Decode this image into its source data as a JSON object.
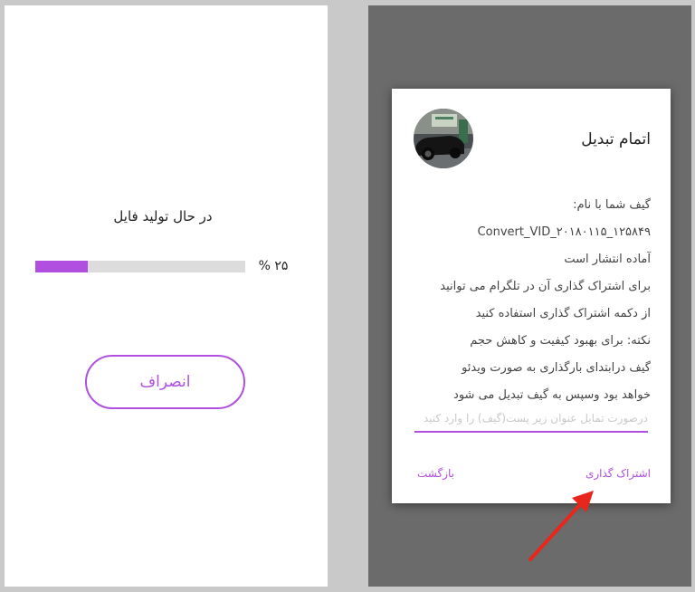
{
  "progress_screen": {
    "title": "در حال تولید فایل",
    "progress": 0.25,
    "percent_label": "۲۵ %",
    "cancel_label": "انصراف"
  },
  "dialog": {
    "title": "اتمام تبدیل",
    "message_lines": [
      "گیف شما با نام:",
      "Convert_VID_۲۰۱۸۰۱۱۵_۱۲۵۸۴۹",
      "آماده انتشار است",
      "برای اشتراک گذاری آن در تلگرام می توانید",
      "از دکمه اشتراک گذاری استفاده کنید",
      "نکته: برای بهبود کیفیت و کاهش حجم",
      "گیف درابتدای بارگذاری به صورت ویدئو",
      "خواهد بود وسپس به گیف تبدیل می شود"
    ],
    "caption_placeholder": "درصورت تمایل عنوان زیر پست(گیف) را وارد کنید",
    "share_label": "اشتراک گذاری",
    "back_label": "بازگشت"
  },
  "colors": {
    "accent": "#b04fe0",
    "overlay": "#6b6b6b",
    "arrow": "#e8261b"
  },
  "icons": {
    "thumbnail": "car-thumbnail",
    "annotation": "red-arrow"
  }
}
